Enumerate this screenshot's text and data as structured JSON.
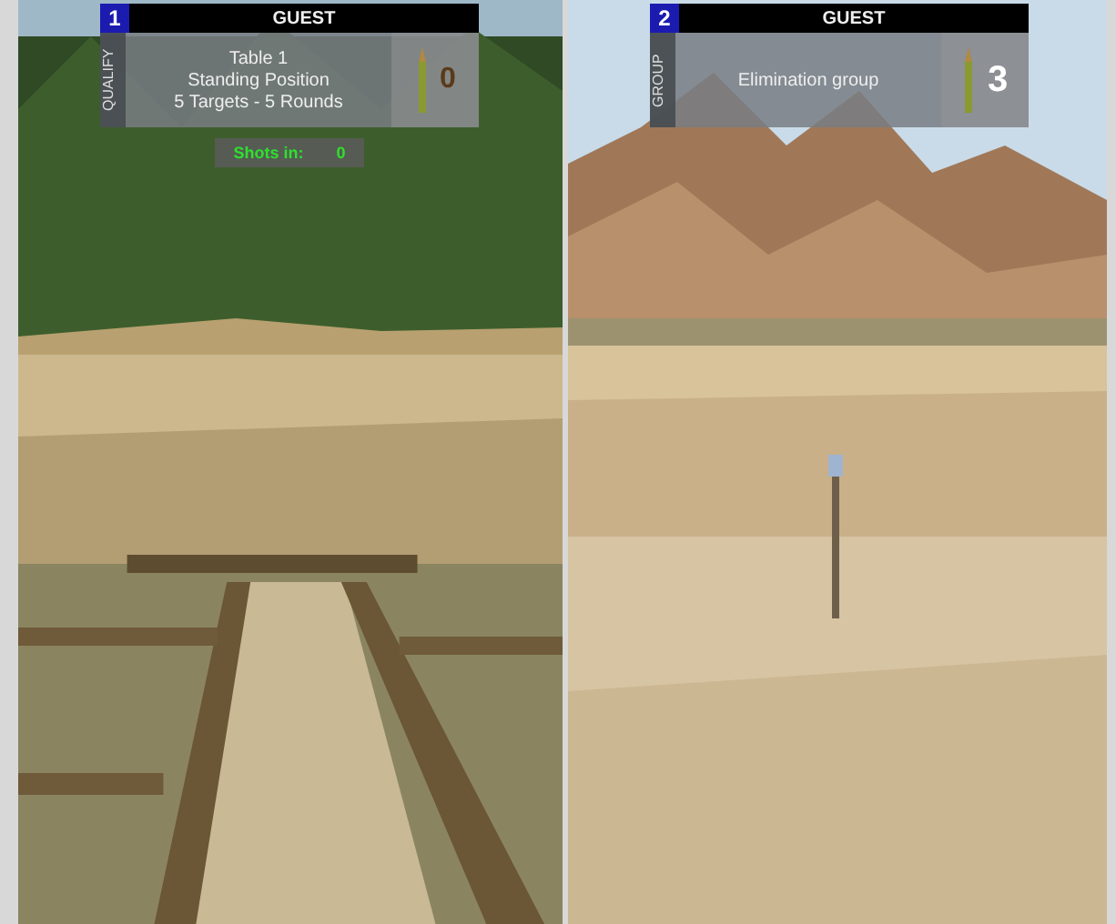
{
  "views": [
    {
      "number": "1",
      "player": "GUEST",
      "mode": "QUALIFY",
      "lines": [
        "Table 1",
        "Standing Position",
        "5 Targets - 5 Rounds"
      ],
      "rounds": "0",
      "shots": {
        "label": "Shots in:",
        "value": "0"
      }
    },
    {
      "number": "2",
      "player": "GUEST",
      "mode": "GROUP",
      "lines": [
        "Elimination group"
      ],
      "rounds": "3"
    }
  ]
}
